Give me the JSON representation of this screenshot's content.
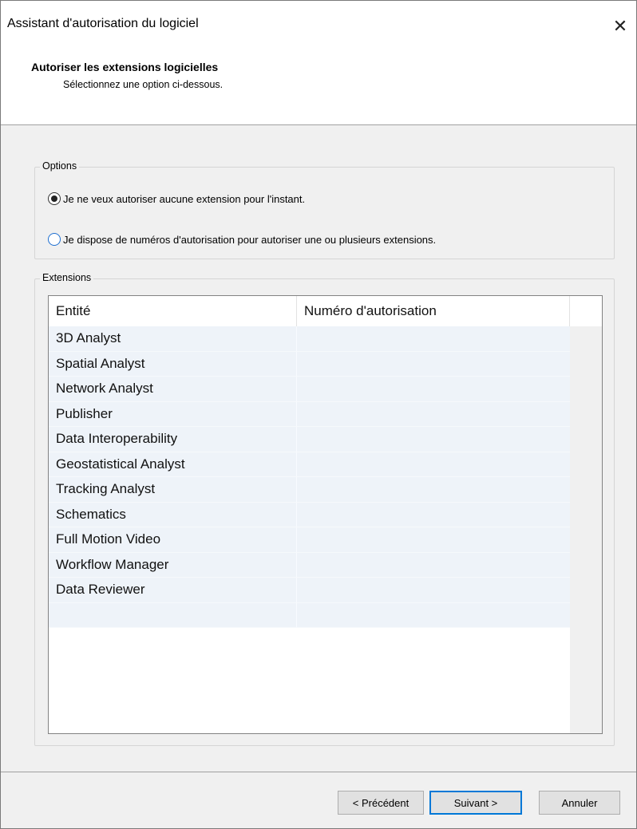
{
  "window": {
    "title": "Assistant d'autorisation du logiciel",
    "close_label": "✕"
  },
  "header": {
    "title": "Autoriser les extensions logicielles",
    "subtitle": "Sélectionnez une option ci-dessous."
  },
  "options": {
    "label": "Options",
    "choice_none": "Je ne veux autoriser aucune extension pour l'instant.",
    "choice_numbers": "Je dispose de numéros d'autorisation pour autoriser une ou plusieurs extensions.",
    "selected": "choice_none"
  },
  "extensions": {
    "label": "Extensions",
    "columns": [
      "Entité",
      "Numéro d'autorisation",
      ""
    ],
    "rows": [
      {
        "entity": "3D Analyst",
        "number": ""
      },
      {
        "entity": "Spatial Analyst",
        "number": ""
      },
      {
        "entity": "Network Analyst",
        "number": ""
      },
      {
        "entity": "Publisher",
        "number": ""
      },
      {
        "entity": "Data Interoperability",
        "number": ""
      },
      {
        "entity": "Geostatistical Analyst",
        "number": ""
      },
      {
        "entity": "Tracking Analyst",
        "number": ""
      },
      {
        "entity": "Schematics",
        "number": ""
      },
      {
        "entity": "Full Motion Video",
        "number": ""
      },
      {
        "entity": "Workflow Manager",
        "number": ""
      },
      {
        "entity": "Data Reviewer",
        "number": ""
      },
      {
        "entity": "",
        "number": ""
      }
    ]
  },
  "buttons": {
    "previous": "< Précédent",
    "next": "Suivant >",
    "cancel": "Annuler"
  }
}
